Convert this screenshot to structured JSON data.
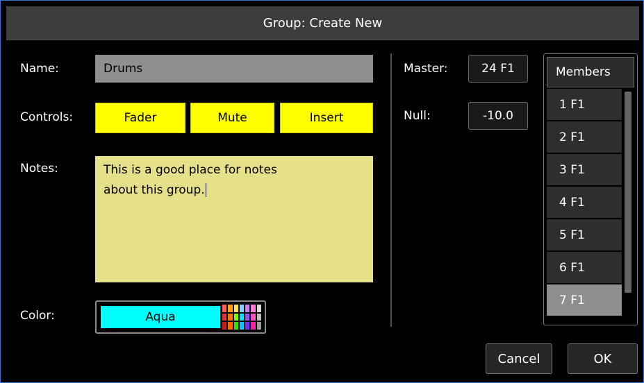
{
  "dialog": {
    "title": "Group: Create New"
  },
  "name": {
    "label": "Name:",
    "value": "Drums"
  },
  "controls": {
    "label": "Controls:",
    "buttons": [
      "Fader",
      "Mute",
      "Insert"
    ]
  },
  "notes": {
    "label": "Notes:",
    "value": "This is a good place for notes\nabout this group."
  },
  "color": {
    "label": "Color:",
    "value": "Aqua",
    "swatch": "#00ffff",
    "palette": [
      [
        "#ff5b5b",
        "#ff9f1c",
        "#ffe14d",
        "#7ad4ff",
        "#c77dff",
        "#ff7ad8",
        "#d9d9d9"
      ],
      [
        "#e23232",
        "#ff7a00",
        "#7fff00",
        "#00e5ff",
        "#9b4dff",
        "#ff4dc4",
        "#bdbdbd"
      ],
      [
        "#c81e1e",
        "#ff6600",
        "#36e000",
        "#00c8ff",
        "#7a2cff",
        "#ff1fa8",
        "#9e9e9e"
      ]
    ]
  },
  "master": {
    "label": "Master:",
    "value": "24 F1"
  },
  "null_field": {
    "label": "Null:",
    "value": "-10.0"
  },
  "members": {
    "header": "Members",
    "items": [
      "1 F1",
      "2 F1",
      "3 F1",
      "4 F1",
      "5 F1",
      "6 F1",
      "7 F1"
    ],
    "selected_index": 6
  },
  "footer": {
    "cancel": "Cancel",
    "ok": "OK"
  }
}
